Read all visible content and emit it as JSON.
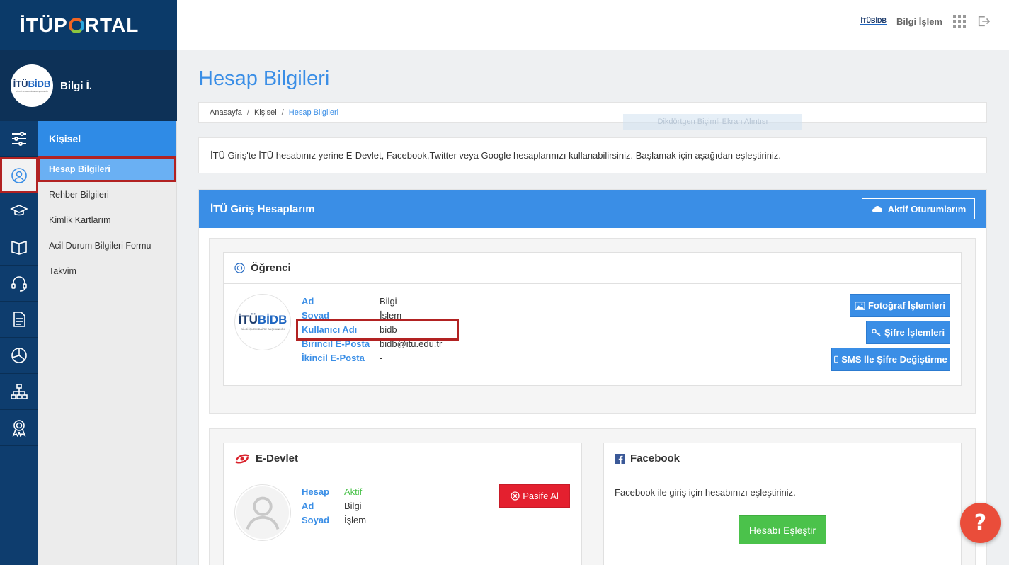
{
  "brand": {
    "logo_prefix": "İTÜP",
    "logo_suffix": "RTAL",
    "org_logo_main": "İTÜ",
    "org_logo_bold": "BİDB",
    "org_logo_sub": "BİLGİ İŞLEM DAİRE BAŞKANLIĞI"
  },
  "profile": {
    "name": "Bilgi İ."
  },
  "topbar": {
    "mini_logo": "İTÜBİDB",
    "user": "Bilgi İşlem"
  },
  "menu": {
    "header": "Kişisel",
    "items": [
      {
        "label": "Hesap Bilgileri"
      },
      {
        "label": "Rehber Bilgileri"
      },
      {
        "label": "Kimlik Kartlarım"
      },
      {
        "label": "Acil Durum Bilgileri Formu"
      },
      {
        "label": "Takvim"
      }
    ]
  },
  "page": {
    "title": "Hesap Bilgileri",
    "breadcrumb": [
      "Anasayfa",
      "Kişisel",
      "Hesap Bilgileri"
    ],
    "breadcrumb_sep": "/",
    "ghost_overlay": "Dikdörtgen Biçimli Ekran Alıntısı",
    "info": "İTÜ Giriş'te İTÜ hesabınız yerine E-Devlet, Facebook,Twitter veya Google hesaplarınızı kullanabilirsiniz. Başlamak için aşağıdan eşleştiriniz."
  },
  "accounts": {
    "title": "İTÜ Giriş Hesaplarım",
    "sessions_button": "Aktif Oturumlarım",
    "student": {
      "title": "Öğrenci",
      "fields": [
        {
          "key": "Ad",
          "value": "Bilgi"
        },
        {
          "key": "Soyad",
          "value": "İşlem"
        },
        {
          "key": "Kullanıcı Adı",
          "value": "bidb"
        },
        {
          "key": "Birincil E-Posta",
          "value": "bidb@itu.edu.tr"
        },
        {
          "key": "İkincil E-Posta",
          "value": "-"
        }
      ],
      "buttons": {
        "photo": "Fotoğraf İşlemleri",
        "password": "Şifre İşlemleri",
        "sms": "SMS İle Şifre Değiştirme"
      }
    },
    "edevlet": {
      "title": "E-Devlet",
      "fields": [
        {
          "key": "Hesap",
          "value": "Aktif"
        },
        {
          "key": "Ad",
          "value": "Bilgi"
        },
        {
          "key": "Soyad",
          "value": "İşlem"
        }
      ],
      "deactivate_button": "Pasife Al"
    },
    "facebook": {
      "title": "Facebook",
      "text": "Facebook ile giriş için hesabınızı eşleştiriniz.",
      "match_button": "Hesabı Eşleştir"
    }
  },
  "help": {
    "label": "?"
  },
  "colors": {
    "accent": "#3a8ee6",
    "sidebar": "#0d3a6a",
    "danger": "#e4202f",
    "success": "#4bc24b",
    "highlight": "#b22222"
  }
}
